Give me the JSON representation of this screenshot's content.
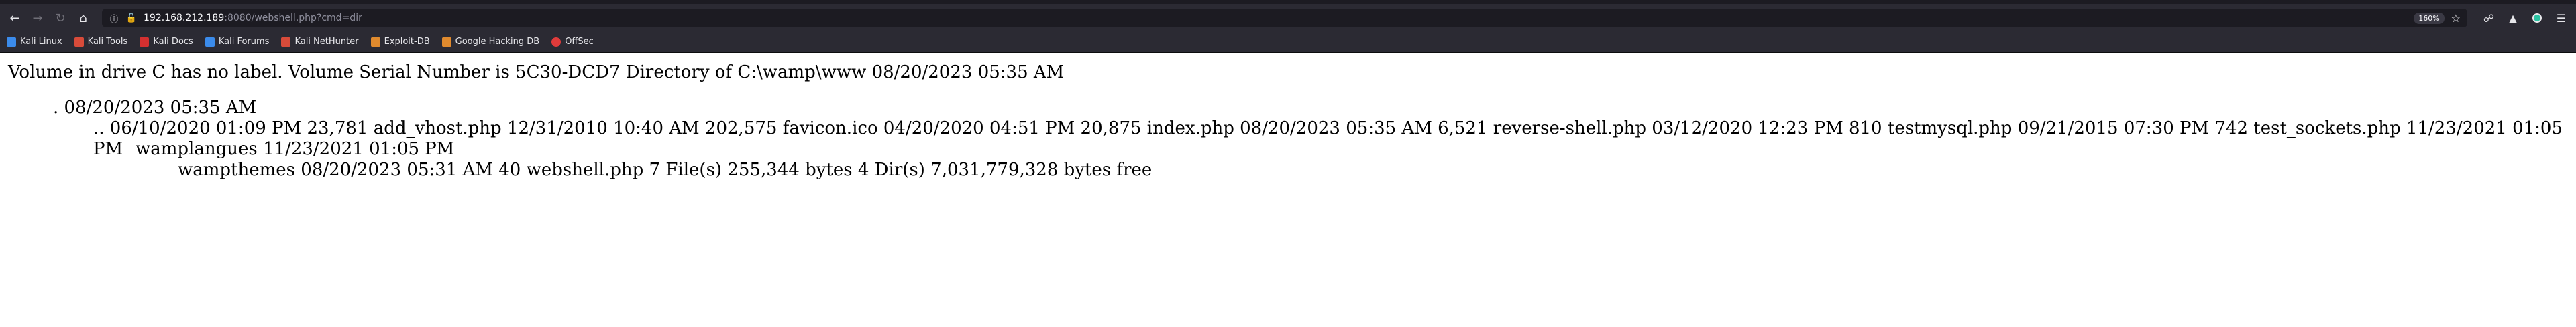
{
  "browser": {
    "url_host": "192.168.212.189",
    "url_rest": ":8080/webshell.php?cmd=dir",
    "zoom": "160%"
  },
  "bookmarks": [
    {
      "label": "Kali Linux",
      "color": "#3b8beb"
    },
    {
      "label": "Kali Tools",
      "color": "#d84b3a"
    },
    {
      "label": "Kali Docs",
      "color": "#d43030"
    },
    {
      "label": "Kali Forums",
      "color": "#3b8beb"
    },
    {
      "label": "Kali NetHunter",
      "color": "#d84b3a"
    },
    {
      "label": "Exploit-DB",
      "color": "#e08a2e"
    },
    {
      "label": "Google Hacking DB",
      "color": "#e08a2e"
    },
    {
      "label": "OffSec",
      "color": "#e03b3b"
    }
  ],
  "content": {
    "line1": "Volume in drive C has no label. Volume Serial Number is 5C30-DCD7 Directory of C:\\wamp\\www 08/20/2023 05:35 AM",
    "line2": ". 08/20/2023 05:35 AM",
    "line3": ".. 06/10/2020 01:09 PM 23,781 add_vhost.php 12/31/2010 10:40 AM 202,575 favicon.ico 04/20/2020 04:51 PM 20,875 index.php 08/20/2023 05:35 AM 6,521 reverse-shell.php 03/12/2020 12:23 PM 810 testmysql.php 09/21/2015 07:30 PM 742 test_sockets.php 11/23/2021 01:05 PM",
    "line4": "wamplangues 11/23/2021 01:05 PM",
    "line5": "wampthemes 08/20/2023 05:31 AM 40 webshell.php 7 File(s) 255,344 bytes 4 Dir(s) 7,031,779,328 bytes free"
  }
}
